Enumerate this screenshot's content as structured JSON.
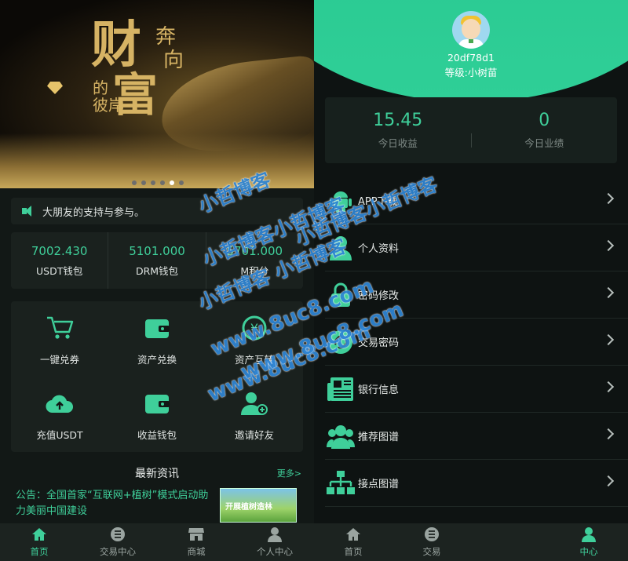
{
  "left": {
    "banner": {
      "line1": "财",
      "line2": "富",
      "small1": "奔",
      "small2": "向",
      "small3": "的",
      "small4": "彼岸"
    },
    "notice": {
      "text": "大朋友的支持与参与。"
    },
    "wallets": [
      {
        "value": "7002.430",
        "label": "USDT钱包"
      },
      {
        "value": "5101.000",
        "label": "DRM钱包"
      },
      {
        "value": "5701.000",
        "label": "M积分"
      }
    ],
    "actions": [
      {
        "label": "一键兑券",
        "icon": "cart-icon"
      },
      {
        "label": "资产兑换",
        "icon": "wallet-icon"
      },
      {
        "label": "资产互转",
        "icon": "yen-exchange-icon"
      },
      {
        "label": "充值USDT",
        "icon": "cloud-upload-icon"
      },
      {
        "label": "收益钱包",
        "icon": "wallet-icon"
      },
      {
        "label": "邀请好友",
        "icon": "add-user-icon"
      }
    ],
    "news": {
      "title": "最新资讯",
      "more": "更多>",
      "item_text": "公告：全国首家“互联网+植树”模式启动助力美丽中国建设",
      "thumb_text": "开展植树造林"
    },
    "tabs": [
      {
        "label": "首页",
        "icon": "home-icon",
        "active": true
      },
      {
        "label": "交易中心",
        "icon": "list-icon",
        "active": false
      },
      {
        "label": "商城",
        "icon": "store-icon",
        "active": false
      },
      {
        "label": "个人中心",
        "icon": "user-icon",
        "active": false
      }
    ]
  },
  "right": {
    "user": {
      "name": "20df78d1",
      "level": "等级:小树苗"
    },
    "stats": [
      {
        "value": "15.45",
        "label": "今日收益"
      },
      {
        "value": "0",
        "label": "今日业绩"
      }
    ],
    "menu": [
      {
        "label": "APP下载",
        "icon": "android-icon"
      },
      {
        "label": "个人资料",
        "icon": "user-icon"
      },
      {
        "label": "密码修改",
        "icon": "lock-icon"
      },
      {
        "label": "交易密码",
        "icon": "link-icon"
      },
      {
        "label": "银行信息",
        "icon": "newspaper-icon"
      },
      {
        "label": "推荐图谱",
        "icon": "group-icon"
      },
      {
        "label": "接点图谱",
        "icon": "sitemap-icon"
      }
    ],
    "tabs": [
      {
        "label": "首页",
        "icon": "home-icon",
        "active": false
      },
      {
        "label": "交易",
        "icon": "list-icon",
        "active": false
      },
      {
        "label": "",
        "icon": "",
        "active": false
      },
      {
        "label": "中心",
        "icon": "user-icon",
        "active": true
      }
    ]
  },
  "watermark": {
    "a": "小哲博客",
    "b": "小哲博客小哲博客",
    "c": "小哲博客 小哲博客",
    "d": "小哲博客小哲博客",
    "e": "www.8uc8.com",
    "f": "www.8uc8.com",
    "g": "www.8uc8.com"
  },
  "colors": {
    "accent": "#3fcf9a",
    "hero": "#2fcf97",
    "bg": "#121816",
    "watermark": "#2f86d6"
  }
}
